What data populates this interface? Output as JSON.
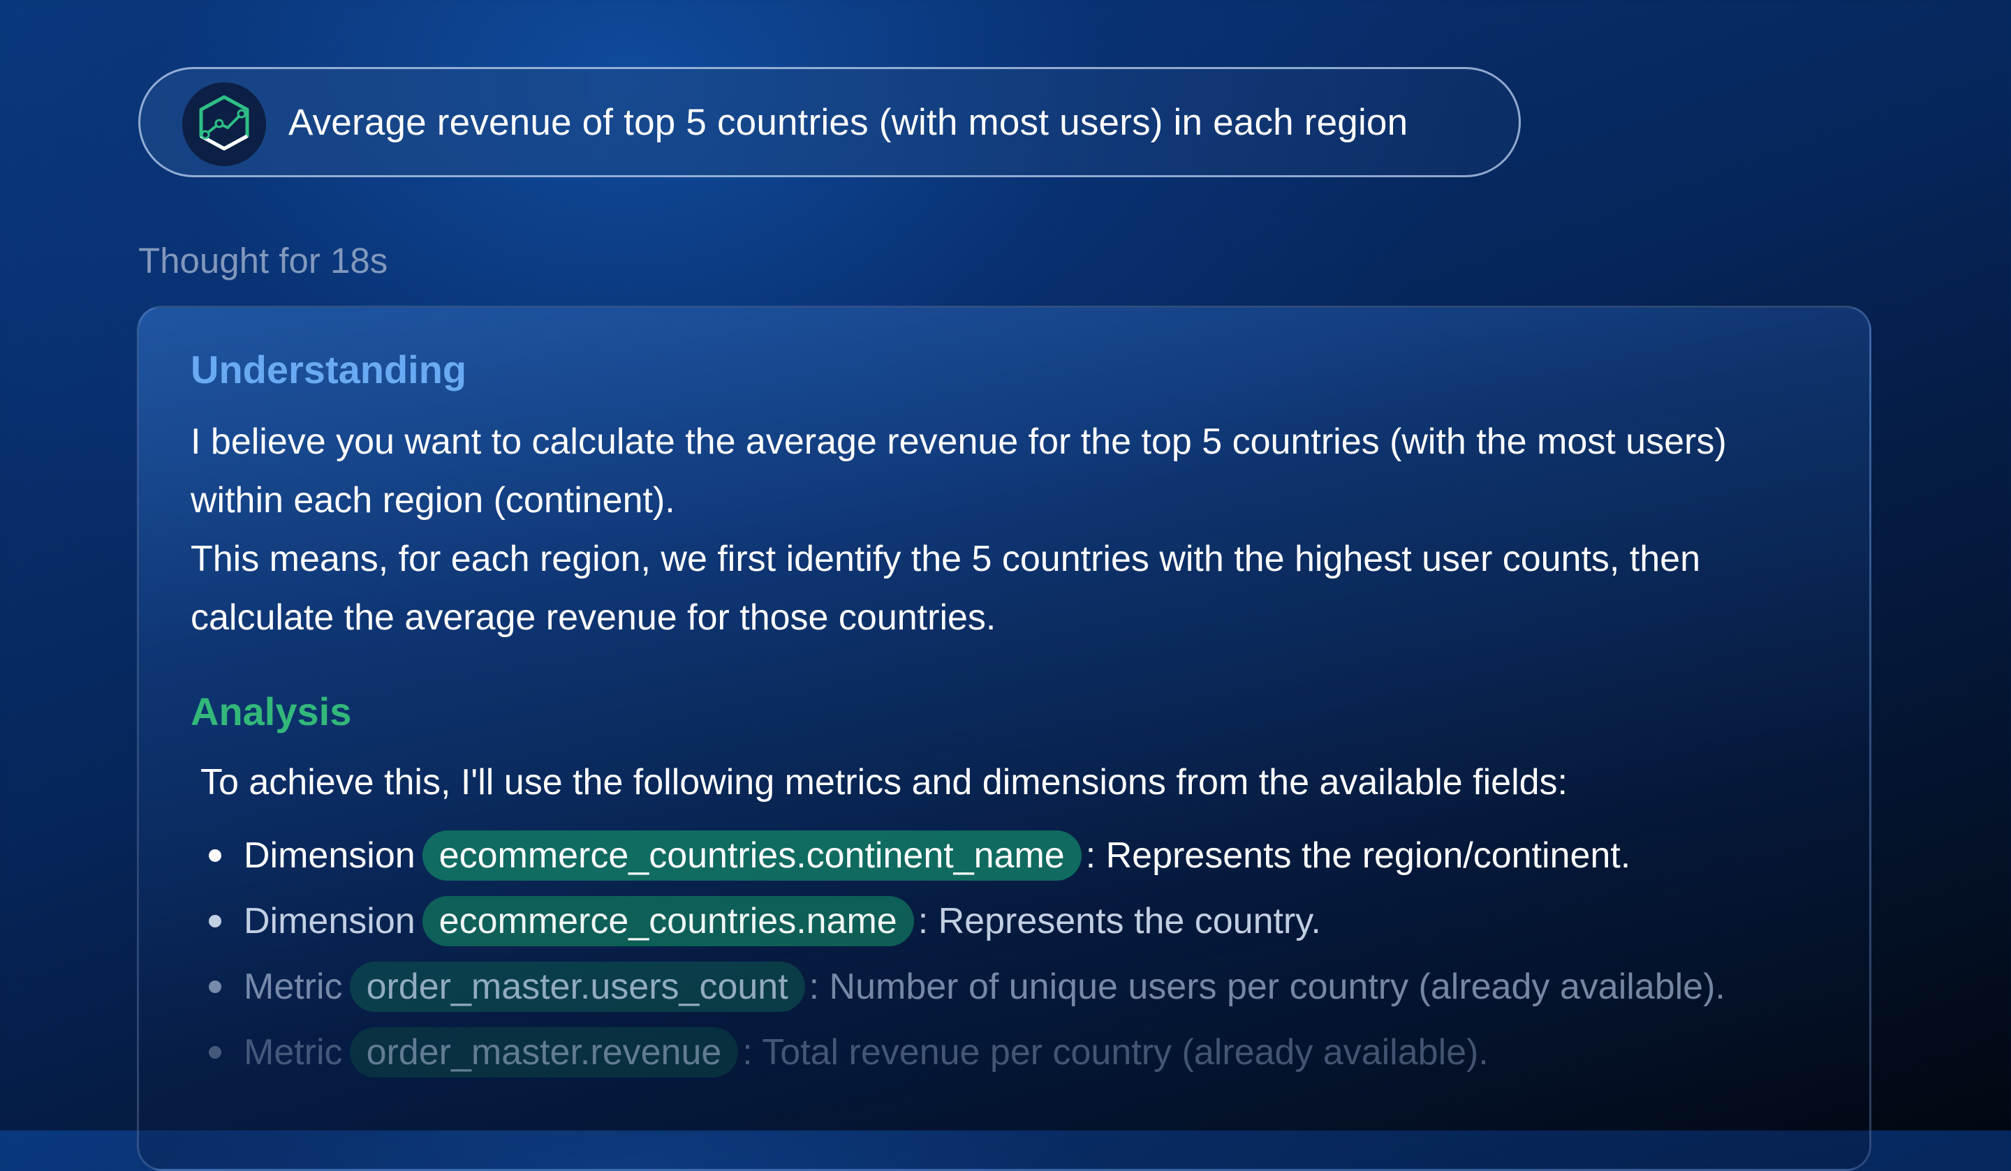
{
  "prompt": {
    "text": "Average revenue of top 5 countries (with most users) in each region",
    "logo_icon": "hexagon-chart-icon"
  },
  "status": {
    "thought_label": "Thought for 18s"
  },
  "response": {
    "understanding": {
      "heading": "Understanding",
      "heading_color": "#6aaaf2",
      "paragraph_1": "I believe you want to calculate the average revenue for the top 5 countries (with the most users) within each region (continent).",
      "paragraph_2": "This means, for each region, we first identify the 5 countries with the highest user counts, then calculate the average revenue for those countries."
    },
    "analysis": {
      "heading": "Analysis",
      "heading_color": "#33b87a",
      "intro": "To achieve this, I'll use the following metrics and dimensions from the available fields:",
      "items": [
        {
          "kind": "Dimension",
          "field": "ecommerce_countries.continent_name",
          "description": ": Represents the region/continent."
        },
        {
          "kind": "Dimension",
          "field": "ecommerce_countries.name",
          "description": ": Represents the country."
        },
        {
          "kind": "Metric",
          "field": "order_master.users_count",
          "description": ": Number of unique users per country (already available)."
        },
        {
          "kind": "Metric",
          "field": "order_master.revenue",
          "description": ": Total revenue per country (already available)."
        }
      ]
    }
  },
  "colors": {
    "field_chip": "#127864"
  }
}
